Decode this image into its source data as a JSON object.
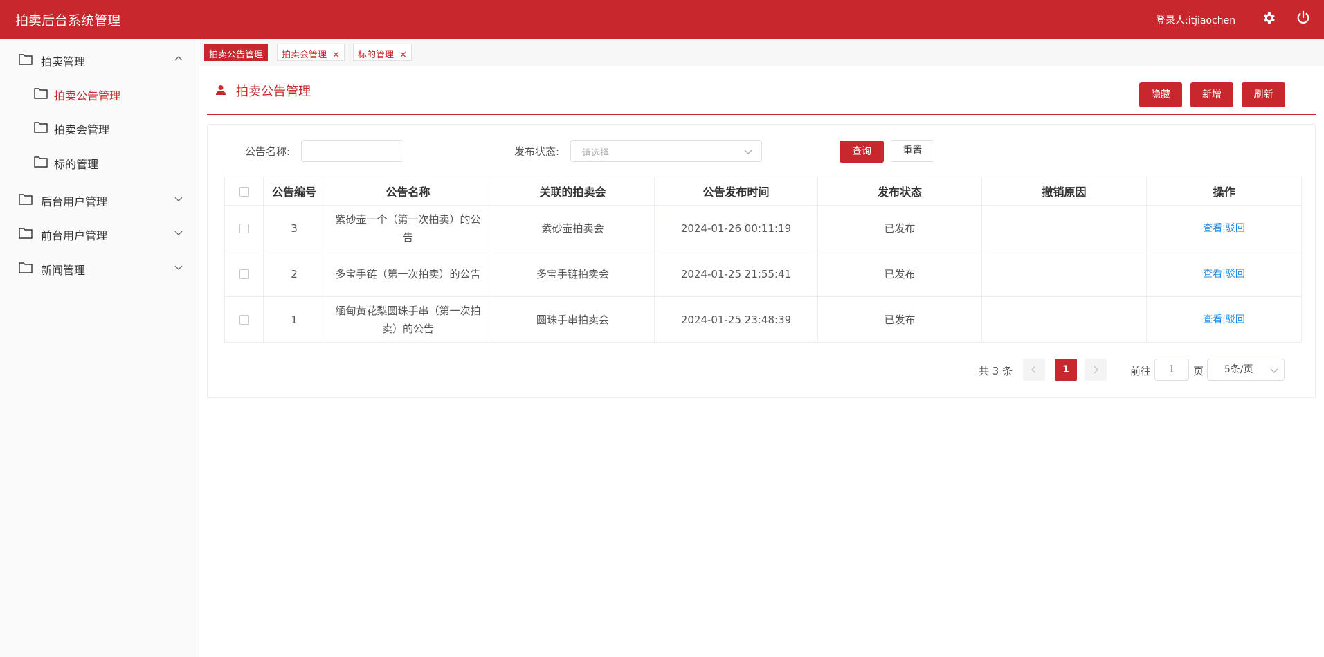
{
  "header": {
    "app_title": "拍卖后台系统管理",
    "login_user": "登录人:itjiaochen",
    "settings_icon": "gear-icon",
    "logout_icon": "power-icon"
  },
  "sidebar": {
    "items": [
      {
        "label": "拍卖管理",
        "expanded": true
      },
      {
        "label": "拍卖公告管理",
        "active": true
      },
      {
        "label": "拍卖会管理"
      },
      {
        "label": "标的管理"
      },
      {
        "label": "后台用户管理",
        "expanded": false
      },
      {
        "label": "前台用户管理",
        "expanded": false
      },
      {
        "label": "新闻管理",
        "expanded": false
      }
    ]
  },
  "tabs": [
    {
      "label": "拍卖公告管理",
      "active": true
    },
    {
      "label": "拍卖会管理",
      "close": "×"
    },
    {
      "label": "标的管理",
      "close": "×"
    }
  ],
  "panel": {
    "title": "拍卖公告管理",
    "hide_label": "隐藏",
    "add_label": "新增",
    "refresh_label": "刷新"
  },
  "filters": {
    "name_label": "公告名称:",
    "name_value": "",
    "status_label": "发布状态:",
    "status_placeholder": "请选择",
    "query_label": "查询",
    "reset_label": "重置"
  },
  "table": {
    "columns": [
      "公告编号",
      "公告名称",
      "关联的拍卖会",
      "公告发布时间",
      "发布状态",
      "撤销原因",
      "操作"
    ],
    "rows": [
      {
        "id": "3",
        "name": "紫砂壶一个（第一次拍卖）的公告",
        "auction": "紫砂壶拍卖会",
        "time": "2024-01-26 00:11:19",
        "status": "已发布",
        "reason": ""
      },
      {
        "id": "2",
        "name": "多宝手链（第一次拍卖）的公告",
        "auction": "多宝手链拍卖会",
        "time": "2024-01-25 21:55:41",
        "status": "已发布",
        "reason": ""
      },
      {
        "id": "1",
        "name": "缅甸黄花梨圆珠手串（第一次拍卖）的公告",
        "auction": "圆珠手串拍卖会",
        "time": "2024-01-25 23:48:39",
        "status": "已发布",
        "reason": ""
      }
    ],
    "action_view": "查看",
    "action_sep": "|",
    "action_revoke": "驳回"
  },
  "pagination": {
    "total": "共 3 条",
    "current_page": "1",
    "goto_label": "前往",
    "goto_value": "1",
    "page_unit": "页",
    "page_size": "5条/页"
  }
}
